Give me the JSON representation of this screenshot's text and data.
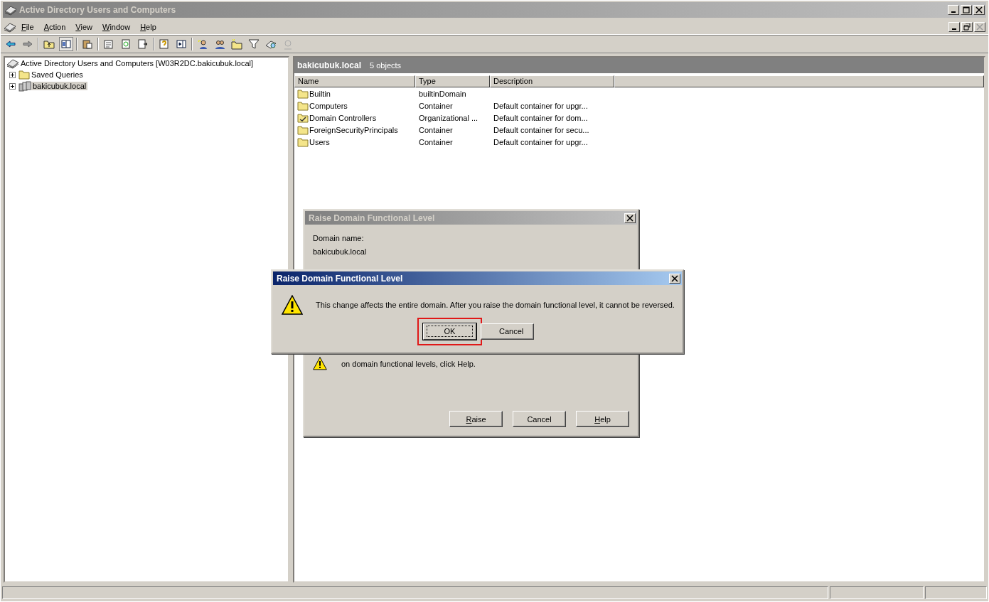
{
  "window": {
    "title": "Active Directory Users and Computers",
    "active": false
  },
  "menu": [
    {
      "label": "File",
      "access_key": true
    },
    {
      "label": "Action",
      "access_key": true
    },
    {
      "label": "View",
      "access_key": true
    },
    {
      "label": "Window",
      "access_key": true
    },
    {
      "label": "Help",
      "access_key": true
    }
  ],
  "tree": {
    "label": "Active Directory Users and Computers [W03R2DC.bakicubuk.local]",
    "children": [
      {
        "label": "Saved Queries",
        "kind": "folder",
        "expanded": false,
        "selected": false
      },
      {
        "label": "bakicubuk.local",
        "kind": "domain",
        "expanded": false,
        "selected": true
      }
    ]
  },
  "list_header": {
    "title": "bakicubuk.local",
    "count": "5 objects"
  },
  "table": {
    "columns": [
      "Name",
      "Type",
      "Description"
    ],
    "rows": [
      {
        "kind": "folder",
        "name": "Builtin",
        "type": "builtinDomain",
        "description": ""
      },
      {
        "kind": "folder",
        "name": "Computers",
        "type": "Container",
        "description": "Default container for upgr..."
      },
      {
        "kind": "ou",
        "name": "Domain Controllers",
        "type": "Organizational ...",
        "description": "Default container for dom..."
      },
      {
        "kind": "folder",
        "name": "ForeignSecurityPrincipals",
        "type": "Container",
        "description": "Default container for secu..."
      },
      {
        "kind": "folder",
        "name": "Users",
        "type": "Container",
        "description": "Default container for upgr..."
      }
    ]
  },
  "raise_dialog": {
    "title": "Raise Domain Functional Level",
    "active": false,
    "domain_label": "Domain name:",
    "domain_value": "bakicubuk.local",
    "note": "on domain functional levels, click Help.",
    "buttons": [
      {
        "label": "Raise",
        "access_key": true
      },
      {
        "label": "Cancel",
        "access_key": false
      },
      {
        "label": "Help",
        "access_key": true
      }
    ]
  },
  "confirm_dialog": {
    "title": "Raise Domain Functional Level",
    "active": true,
    "message": "This change affects the entire domain. After you raise the domain functional level, it cannot be reversed.",
    "buttons": [
      {
        "label": "OK",
        "default": true,
        "highlighted": true
      },
      {
        "label": "Cancel",
        "default": false,
        "highlighted": false
      }
    ]
  }
}
